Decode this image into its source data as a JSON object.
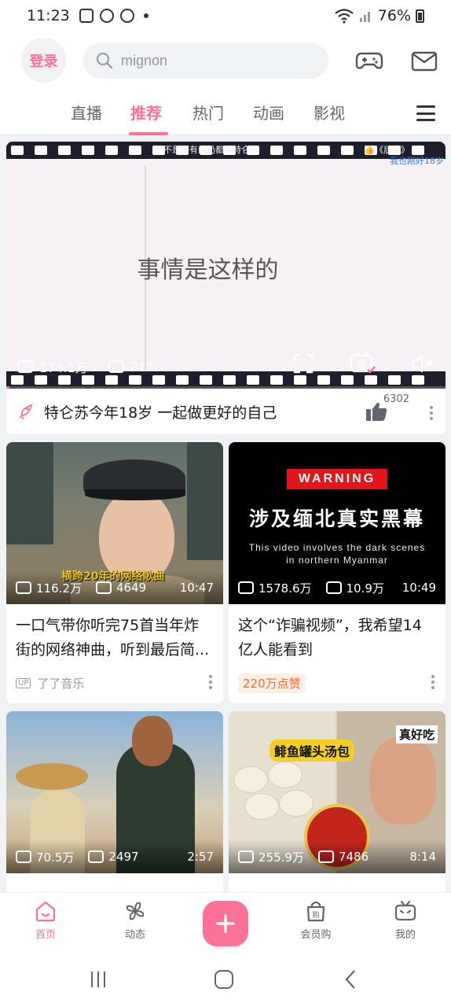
{
  "status_bar": {
    "time": "11:23",
    "battery": "76%"
  },
  "header": {
    "login_label": "登录",
    "search_placeholder": "mignon"
  },
  "tabs": [
    {
      "label": "直播"
    },
    {
      "label": "推荐",
      "active": true
    },
    {
      "label": "热门"
    },
    {
      "label": "动画"
    },
    {
      "label": "影视"
    }
  ],
  "hero": {
    "top_text": "不是所有的奶都叫特仑苏",
    "top_right_text": "👍《后浪》",
    "blue_text": "我也刚好18岁",
    "caption": "事情是这样的",
    "views": "174.1万",
    "danmaku": "212",
    "title": "特仑苏今年18岁 一起做更好的自己",
    "likes": "6302"
  },
  "cards": [
    {
      "views": "116.2万",
      "danmaku": "4649",
      "duration": "10:47",
      "subtitle_overlay": "横跨20年的网络歌曲",
      "title": "一口气带你听完75首当年炸街的网络神曲，听到最后简...",
      "meta_type": "up",
      "up_badge": "UP",
      "author": "了了音乐"
    },
    {
      "views": "1578.6万",
      "danmaku": "10.9万",
      "duration": "10:49",
      "warning": "WARNING",
      "headline": "涉及缅北真实黑幕",
      "english_line1": "This video involves the dark scenes",
      "english_line2": "in northern Myanmar",
      "title": "这个“诈骗视频”，我希望14亿人能看到",
      "meta_type": "likes",
      "like_badge": "220万点赞"
    },
    {
      "views": "70.5万",
      "danmaku": "2497",
      "duration": "2:57"
    },
    {
      "views": "255.9万",
      "danmaku": "7486",
      "duration": "8:14",
      "overlay_title": "鲱鱼罐头汤包",
      "overlay_right": "真好吃"
    }
  ],
  "bottom_nav": [
    {
      "label": "首页",
      "icon": "home-icon",
      "active": true
    },
    {
      "label": "动态",
      "icon": "pinwheel-icon"
    },
    {
      "label": "会员购",
      "icon": "shopping-bag-icon"
    },
    {
      "label": "我的",
      "icon": "tv-icon"
    }
  ],
  "colors": {
    "brand": "#fb7299",
    "text": "#18191c",
    "muted": "#9499a0"
  }
}
